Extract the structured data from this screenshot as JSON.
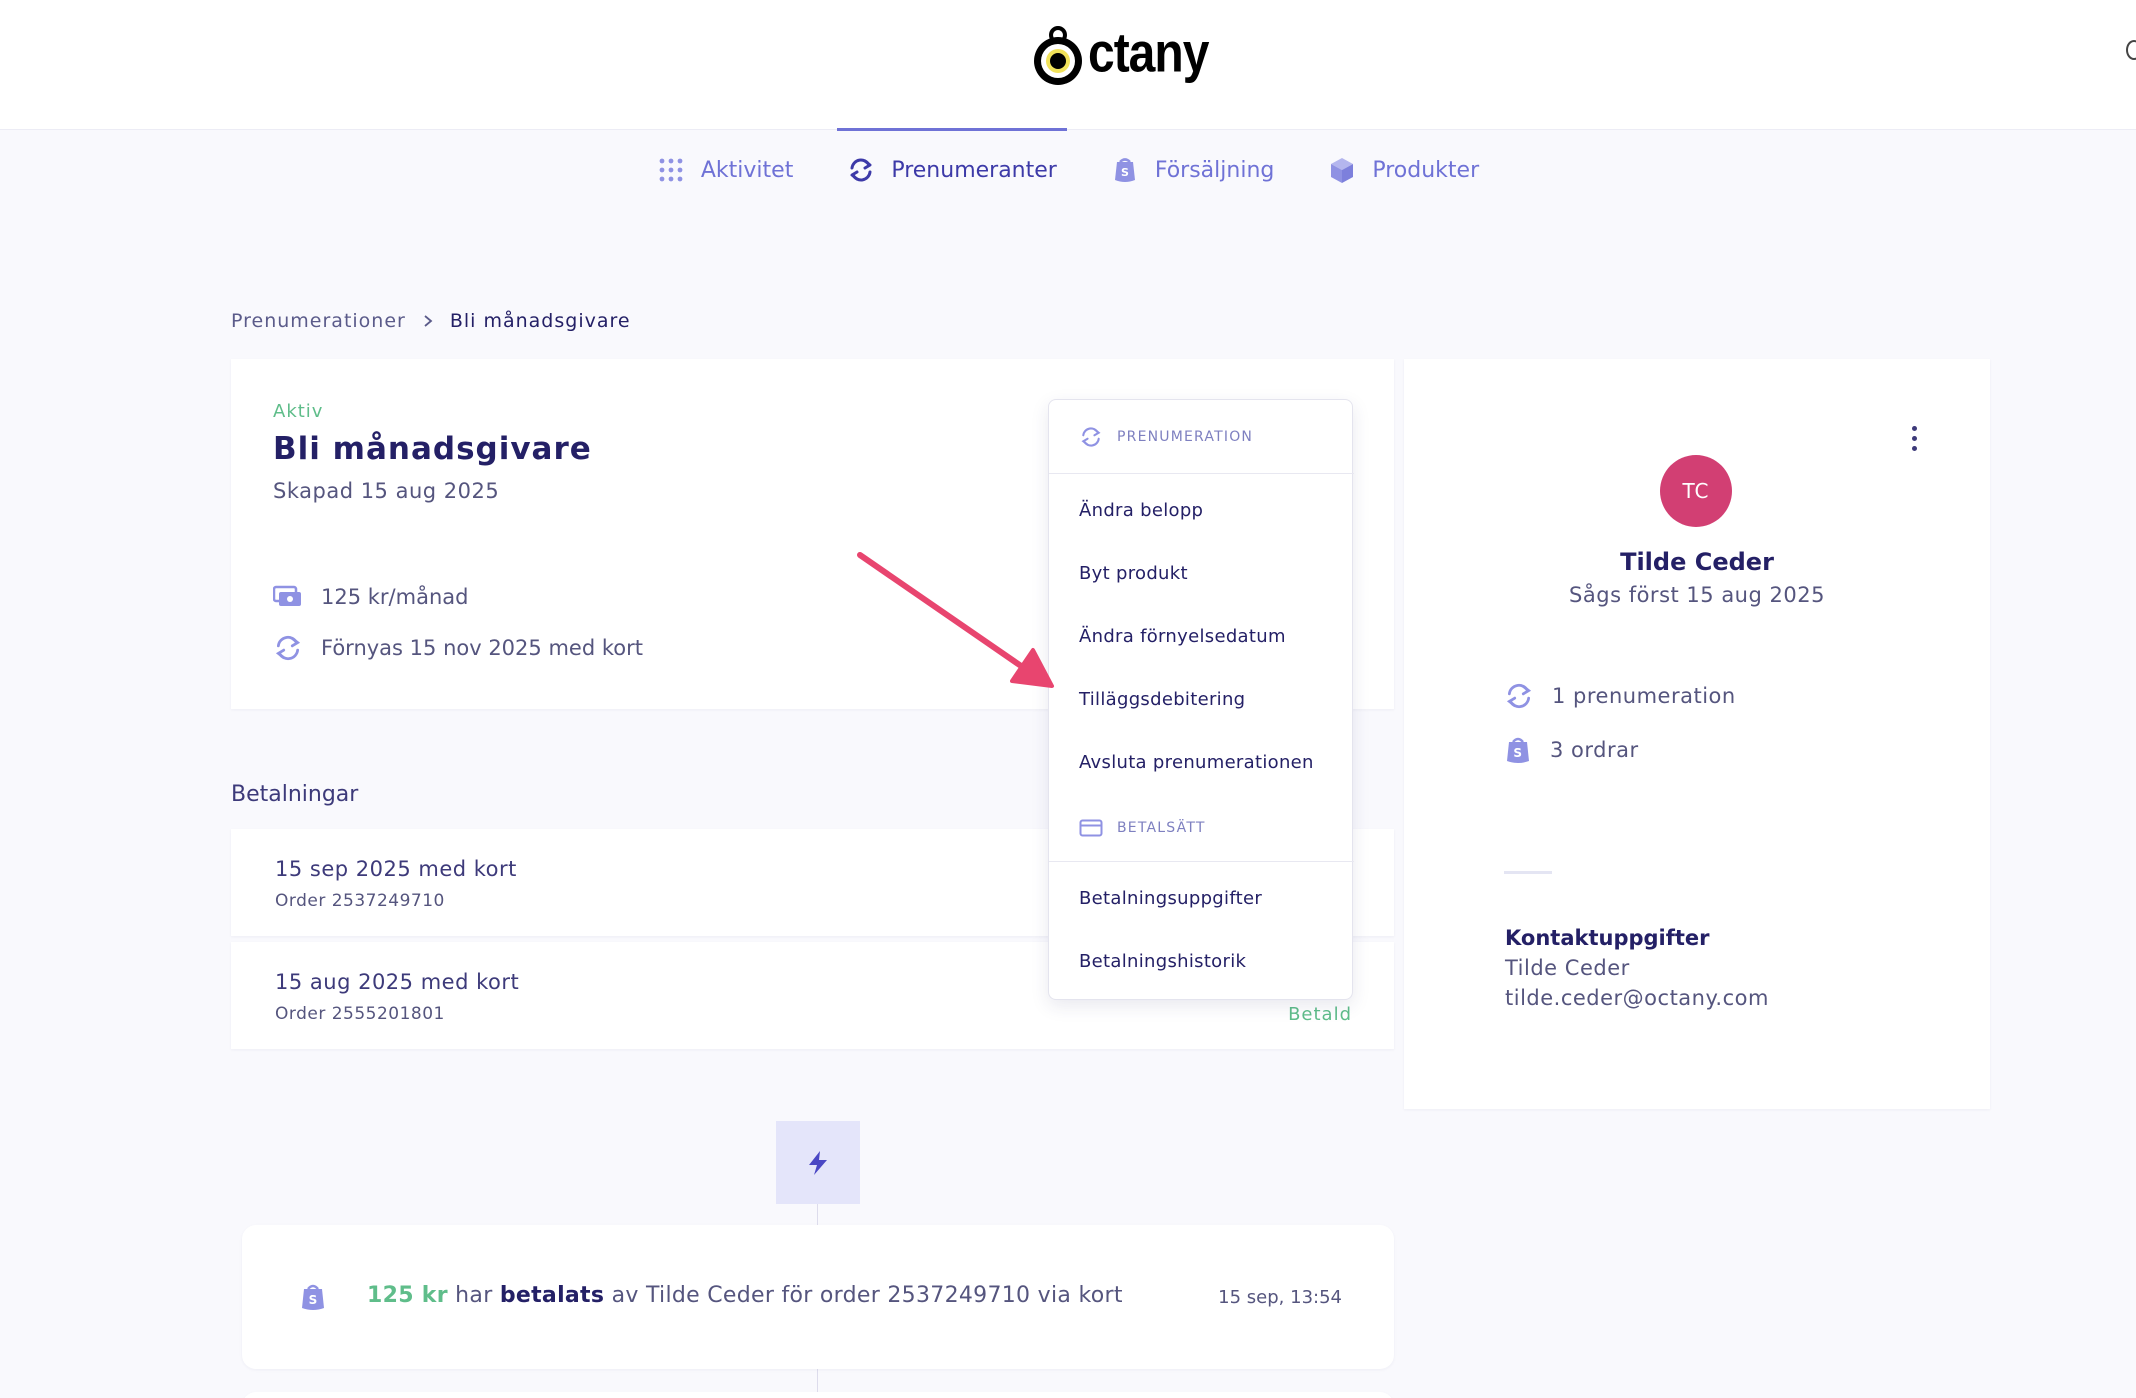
{
  "brand": {
    "name": "ctany"
  },
  "nav": {
    "items": [
      {
        "label": "Aktivitet",
        "icon": "grid-dots-icon"
      },
      {
        "label": "Prenumeranter",
        "icon": "refresh-icon",
        "active": true
      },
      {
        "label": "Försäljning",
        "icon": "shopping-bag-icon"
      },
      {
        "label": "Produkter",
        "icon": "box-icon"
      }
    ]
  },
  "breadcrumb": {
    "parent": "Prenumerationer",
    "current": "Bli månadsgivare"
  },
  "subscription": {
    "status": "Aktiv",
    "title": "Bli månadsgivare",
    "created": "Skapad 15 aug 2025",
    "amount": "125 kr/månad",
    "renewal": "Förnyas 15 nov 2025 med kort"
  },
  "payments": {
    "title": "Betalningar",
    "rows": [
      {
        "date": "15 sep 2025 med kort",
        "order": "Order 2537249710",
        "status": ""
      },
      {
        "date": "15 aug 2025 med kort",
        "order": "Order 2555201801",
        "status": "Betald"
      }
    ]
  },
  "event": {
    "amount": "125 kr",
    "text1": " har ",
    "verb": "betalats",
    "text2": " av Tilde Ceder för order 2537249710 via kort",
    "time": "15 sep, 13:54"
  },
  "customer": {
    "initials": "TC",
    "name": "Tilde Ceder",
    "seen": "Sågs först 15 aug 2025",
    "subscriptions": "1 prenumeration",
    "orders": "3 ordrar",
    "contact_title": "Kontaktuppgifter",
    "contact_name": "Tilde Ceder",
    "contact_email": "tilde.ceder@octany.com"
  },
  "dropdown": {
    "section1": "PRENUMERATION",
    "items1": [
      "Ändra belopp",
      "Byt produkt",
      "Ändra förnyelsedatum",
      "Tilläggsdebitering",
      "Avsluta prenumerationen"
    ],
    "section2": "BETALSÄTT",
    "items2": [
      "Betalningsuppgifter",
      "Betalningshistorik"
    ]
  },
  "colors": {
    "accent": "#6f72d6",
    "success": "#5fbd8a",
    "avatar": "#d23f73",
    "arrow": "#e8456f"
  }
}
